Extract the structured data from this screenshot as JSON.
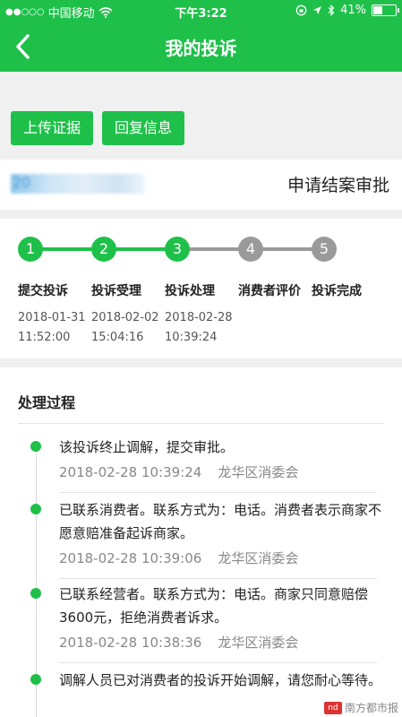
{
  "status_bar": {
    "carrier": "中国移动",
    "time": "下午3:22",
    "battery": "41%",
    "battery_level": 0.41
  },
  "nav": {
    "title": "我的投诉"
  },
  "actions": {
    "upload": "上传证据",
    "reply": "回复信息"
  },
  "complaint": {
    "number_masked": "20",
    "status": "申请结案审批"
  },
  "steps": [
    {
      "num": "1",
      "label": "提交投诉",
      "date": "2018-01-31",
      "time": "11:52:00",
      "done": true
    },
    {
      "num": "2",
      "label": "投诉受理",
      "date": "2018-02-02",
      "time": "15:04:16",
      "done": true
    },
    {
      "num": "3",
      "label": "投诉处理",
      "date": "2018-02-28",
      "time": "10:39:24",
      "done": true
    },
    {
      "num": "4",
      "label": "消费者评价",
      "date": "",
      "time": "",
      "done": false
    },
    {
      "num": "5",
      "label": "投诉完成",
      "date": "",
      "time": "",
      "done": false
    }
  ],
  "process": {
    "title": "处理过程",
    "entries": [
      {
        "text": "该投诉终止调解，提交审批。",
        "datetime": "2018-02-28 10:39:24",
        "org": "龙华区消委会"
      },
      {
        "text": "已联系消费者。联系方式为：电话。消费者表示商家不愿意赔准备起诉商家。",
        "datetime": "2018-02-28 10:39:06",
        "org": "龙华区消委会"
      },
      {
        "text": "已联系经营者。联系方式为：电话。商家只同意赔偿3600元，拒绝消费者诉求。",
        "datetime": "2018-02-28 10:38:36",
        "org": "龙华区消委会"
      },
      {
        "text": "调解人员已对消费者的投诉开始调解，请您耐心等待。",
        "datetime": "",
        "org": ""
      }
    ]
  },
  "watermark": {
    "logo": "nd",
    "text": "南方都市报"
  },
  "colors": {
    "accent": "#1fc04a",
    "inactive": "#9a9a9a"
  }
}
